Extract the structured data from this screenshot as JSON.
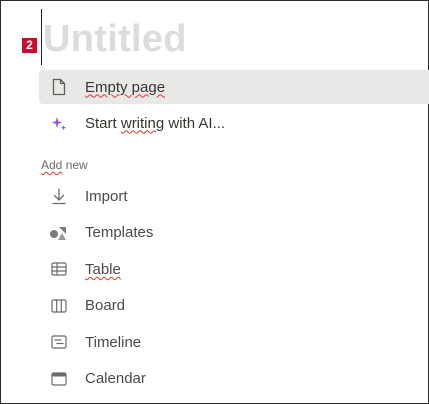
{
  "page": {
    "badge": "2",
    "title": "Untitled"
  },
  "menu_primary": [
    {
      "label": "Empty page",
      "icon": "page-icon",
      "active": true
    },
    {
      "label_prefix": "Start ",
      "label_squiggle": "writing",
      "label_suffix": " with AI...",
      "icon": "ai-sparkle-icon"
    }
  ],
  "section": {
    "label_squiggle": "Add",
    "label_suffix": " new"
  },
  "menu_add": [
    {
      "label": "Import",
      "icon": "import-icon"
    },
    {
      "label": "Templates",
      "icon": "templates-icon"
    },
    {
      "label": "Table",
      "icon": "table-icon"
    },
    {
      "label": "Board",
      "icon": "board-icon"
    },
    {
      "label": "Timeline",
      "icon": "timeline-icon"
    },
    {
      "label": "Calendar",
      "icon": "calendar-icon"
    }
  ],
  "colors": {
    "badge": "#c8102e",
    "title_placeholder": "#dcdcdc",
    "active_row": "#e8e8e6",
    "ai_accent": "#9b59d0"
  }
}
